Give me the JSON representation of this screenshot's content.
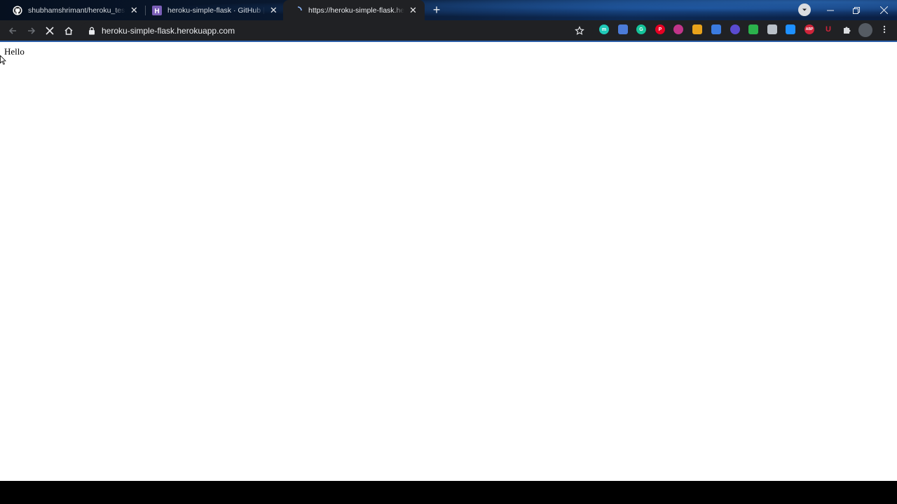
{
  "browser": {
    "tabs": [
      {
        "title": "shubhamshrimant/heroku_test_flask",
        "favicon": "github-icon",
        "active": false
      },
      {
        "title": "heroku-simple-flask · GitHub | Heroku",
        "favicon": "heroku-icon",
        "active": false
      },
      {
        "title": "https://heroku-simple-flask.herokuapp.com",
        "favicon": "loading-icon",
        "active": true
      }
    ],
    "new_tab_label": "+",
    "address_bar": {
      "url": "heroku-simple-flask.herokuapp.com",
      "secure_icon": "lock-icon"
    },
    "navigation": {
      "back_icon": "back-arrow-icon",
      "forward_icon": "forward-arrow-icon",
      "stop_icon": "stop-loading-icon",
      "home_icon": "home-icon"
    },
    "extensions": [
      {
        "name": "mote-extension-icon",
        "label": "m",
        "color": "#1fc9b8"
      },
      {
        "name": "docs-extension-icon",
        "label": "",
        "color": "#4b7bd8"
      },
      {
        "name": "grammarly-icon",
        "label": "G",
        "color": "#15c39a"
      },
      {
        "name": "pinterest-icon",
        "label": "P",
        "color": "#e60023"
      },
      {
        "name": "instagram-extension-icon",
        "label": "",
        "color": "#c1358a"
      },
      {
        "name": "color-picker-extension-icon",
        "label": "",
        "color": "#e8a21b"
      },
      {
        "name": "download-extension-icon",
        "label": "",
        "color": "#3b7be0"
      },
      {
        "name": "night-mode-extension-icon",
        "label": "",
        "color": "#5a4bd1"
      },
      {
        "name": "feedly-extension-icon",
        "label": "",
        "color": "#2bb24c"
      },
      {
        "name": "translate-extension-icon",
        "label": "",
        "color": "#b9c0c8"
      },
      {
        "name": "windows-extension-icon",
        "label": "",
        "color": "#1e90ff"
      },
      {
        "name": "adblock-plus-icon",
        "label": "ABP",
        "color": "#d0243a"
      },
      {
        "name": "ublock-icon",
        "label": "U",
        "color": "#b51d2b"
      },
      {
        "name": "extensions-puzzle-icon",
        "label": "",
        "color": "#dadce0"
      },
      {
        "name": "profile-avatar",
        "label": "",
        "color": "#555b63"
      },
      {
        "name": "menu-kebab-icon",
        "label": "",
        "color": "#dadce0"
      }
    ]
  },
  "page": {
    "body_text": "Hello"
  }
}
